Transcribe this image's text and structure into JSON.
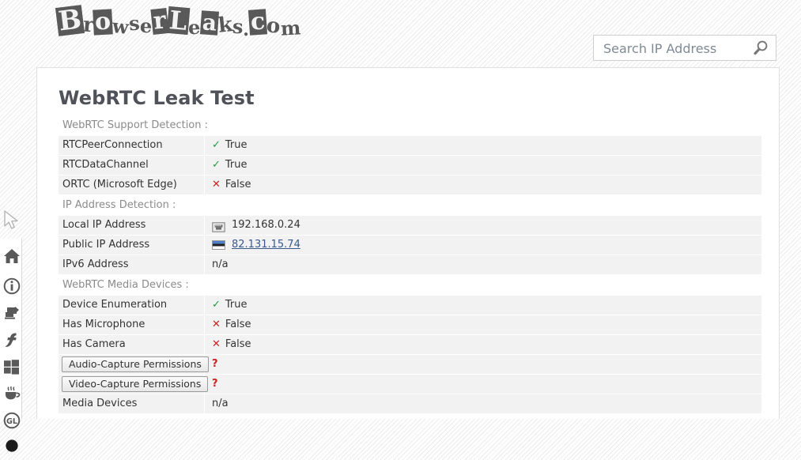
{
  "site": {
    "logo_text": "BrowserLeaks.com",
    "logo_letters": [
      {
        "ch": "B",
        "style": "blk"
      },
      {
        "ch": "r",
        "style": "wht"
      },
      {
        "ch": "o",
        "style": "blk"
      },
      {
        "ch": "w",
        "style": "wht"
      },
      {
        "ch": "s",
        "style": "wht"
      },
      {
        "ch": "e",
        "style": "wht"
      },
      {
        "ch": "r",
        "style": "blk"
      },
      {
        "ch": "L",
        "style": "blk"
      },
      {
        "ch": "e",
        "style": "wht"
      },
      {
        "ch": "a",
        "style": "blk"
      },
      {
        "ch": "k",
        "style": "wht"
      },
      {
        "ch": "s",
        "style": "wht"
      },
      {
        "ch": ".",
        "style": "wht"
      },
      {
        "ch": "c",
        "style": "blk"
      },
      {
        "ch": "o",
        "style": "wht"
      },
      {
        "ch": "m",
        "style": "wht"
      }
    ]
  },
  "search": {
    "placeholder": "Search IP Address",
    "value": "",
    "icon": "search-icon"
  },
  "sidebar": {
    "items": [
      {
        "name": "home-icon",
        "label": "Home"
      },
      {
        "name": "info-icon",
        "label": "Info"
      },
      {
        "name": "javascript-icon",
        "label": "JavaScript"
      },
      {
        "name": "flash-icon",
        "label": "Flash"
      },
      {
        "name": "silverlight-icon",
        "label": "Silverlight"
      },
      {
        "name": "java-icon",
        "label": "Java"
      },
      {
        "name": "webgl-icon",
        "label": "WebGL"
      },
      {
        "name": "canvas-icon",
        "label": "Canvas"
      }
    ]
  },
  "page": {
    "title": "WebRTC Leak Test"
  },
  "sections": [
    {
      "label": "WebRTC Support Detection :",
      "rows": [
        {
          "key": "RTCPeerConnection",
          "status": "true",
          "value": "True",
          "type": "status"
        },
        {
          "key": "RTCDataChannel",
          "status": "true",
          "value": "True",
          "type": "status"
        },
        {
          "key": "ORTC (Microsoft Edge)",
          "status": "false",
          "value": "False",
          "type": "status"
        }
      ]
    },
    {
      "label": "IP Address Detection :",
      "rows": [
        {
          "key": "Local IP Address",
          "value": "192.168.0.24",
          "type": "icon-value",
          "icon": "ethernet-port-icon"
        },
        {
          "key": "Public IP Address",
          "value": "82.131.15.74",
          "type": "flag-link",
          "icon": "flag-estonia-icon"
        },
        {
          "key": "IPv6 Address",
          "value": "n/a",
          "type": "plain"
        }
      ]
    },
    {
      "label": "WebRTC Media Devices :",
      "rows": [
        {
          "key": "Device Enumeration",
          "status": "true",
          "value": "True",
          "type": "status"
        },
        {
          "key": "Has Microphone",
          "status": "false",
          "value": "False",
          "type": "status"
        },
        {
          "key": "Has Camera",
          "status": "false",
          "value": "False",
          "type": "status"
        },
        {
          "key": "Audio-Capture Permissions",
          "value": "?",
          "type": "button"
        },
        {
          "key": "Video-Capture Permissions",
          "value": "?",
          "type": "button"
        },
        {
          "key": "Media Devices",
          "value": "n/a",
          "type": "plain"
        }
      ]
    }
  ],
  "glyphs": {
    "check": "✓",
    "cross": "✕",
    "question": "?"
  },
  "colors": {
    "true_green": "#1f9b3f",
    "false_red": "#cc2222",
    "title_gray": "#4f5258",
    "row_bg": "#f2f2f2",
    "link_blue": "#3a5a8c"
  }
}
